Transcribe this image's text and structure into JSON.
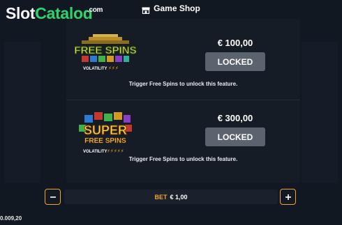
{
  "header": {
    "title": "Game Shop",
    "icon": "shop-icon"
  },
  "watermark": {
    "part1": "Slot",
    "part2": "Catalog",
    "suffix": ".com"
  },
  "offers": [
    {
      "logo_line1": "FREE SPINS",
      "volatility_label": "VOLATILITY",
      "volatility_level": 3,
      "price": "€ 100,00",
      "button_label": "LOCKED",
      "hint": "Trigger Free Spins to unlock this feature."
    },
    {
      "logo_line1": "SUPER",
      "logo_line2": "FREE SPINS",
      "volatility_label": "VOLATILITY",
      "volatility_level": 5,
      "price": "€ 300,00",
      "button_label": "LOCKED",
      "hint": "Trigger Free Spins to unlock this feature."
    }
  ],
  "bet": {
    "label": "BET",
    "value": "€ 1,00"
  },
  "balance": "0.009,20",
  "colors": {
    "accent": "#f5a524",
    "locked": "#5b636e",
    "brand_green": "#2fd36b"
  }
}
